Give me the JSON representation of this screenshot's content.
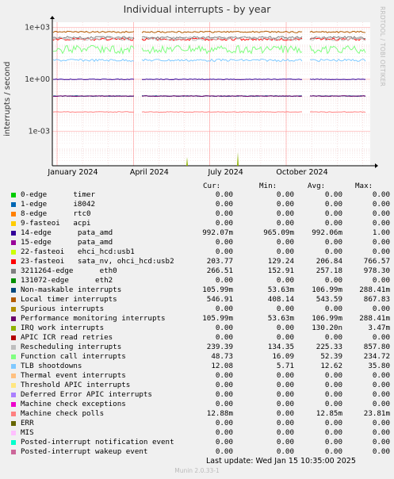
{
  "title": "Individual interrupts - by year",
  "side_text": "RRDTOOL / TOBI OETIKER",
  "footer_update": "Last update:  Wed Jan 15 10:35:00 2025",
  "footer_munin": "Munin 2.0.33-1",
  "chart_data": {
    "type": "line",
    "ylabel": "interrupts / second",
    "yscale": "log",
    "yticks": [
      "1e+03",
      "1e+00",
      "1e-03"
    ],
    "xticks": [
      "January 2024",
      "April 2024",
      "July 2024",
      "October 2024"
    ],
    "grid": true,
    "columns": [
      "Cur:",
      "Min:",
      "Avg:",
      "Max:"
    ],
    "series": [
      {
        "name": "0-edge      timer",
        "color": "#00cc00",
        "cur": "0.00",
        "min": "0.00",
        "avg": "0.00",
        "max": "0.00"
      },
      {
        "name": "1-edge      i8042",
        "color": "#0066b3",
        "cur": "0.00",
        "min": "0.00",
        "avg": "0.00",
        "max": "0.00"
      },
      {
        "name": "8-edge      rtc0",
        "color": "#ff8000",
        "cur": "0.00",
        "min": "0.00",
        "avg": "0.00",
        "max": "0.00"
      },
      {
        "name": "9-fasteoi   acpi",
        "color": "#ffcc00",
        "cur": "0.00",
        "min": "0.00",
        "avg": "0.00",
        "max": "0.00"
      },
      {
        "name": "14-edge      pata_amd",
        "color": "#330099",
        "cur": "992.07m",
        "min": "965.09m",
        "avg": "992.06m",
        "max": "1.00"
      },
      {
        "name": "15-edge      pata_amd",
        "color": "#990099",
        "cur": "0.00",
        "min": "0.00",
        "avg": "0.00",
        "max": "0.00"
      },
      {
        "name": "22-fasteoi   ehci_hcd:usb1",
        "color": "#ccff00",
        "cur": "0.00",
        "min": "0.00",
        "avg": "0.00",
        "max": "0.00"
      },
      {
        "name": "23-fasteoi   sata_nv, ohci_hcd:usb2",
        "color": "#ff0000",
        "cur": "203.77",
        "min": "129.24",
        "avg": "206.84",
        "max": "766.57"
      },
      {
        "name": "3211264-edge      eth0",
        "color": "#808080",
        "cur": "266.51",
        "min": "152.91",
        "avg": "257.18",
        "max": "978.30"
      },
      {
        "name": "131072-edge      eth2",
        "color": "#008f00",
        "cur": "0.00",
        "min": "0.00",
        "avg": "0.00",
        "max": "0.00"
      },
      {
        "name": "Non-maskable interrupts",
        "color": "#00487d",
        "cur": "105.99m",
        "min": "53.63m",
        "avg": "106.99m",
        "max": "288.41m"
      },
      {
        "name": "Local timer interrupts",
        "color": "#b35a00",
        "cur": "546.91",
        "min": "408.14",
        "avg": "543.59",
        "max": "867.83"
      },
      {
        "name": "Spurious interrupts",
        "color": "#b38f00",
        "cur": "0.00",
        "min": "0.00",
        "avg": "0.00",
        "max": "0.00"
      },
      {
        "name": "Performance monitoring interrupts",
        "color": "#6b006b",
        "cur": "105.99m",
        "min": "53.63m",
        "avg": "106.99m",
        "max": "288.41m"
      },
      {
        "name": "IRQ work interrupts",
        "color": "#8fb300",
        "cur": "0.00",
        "min": "0.00",
        "avg": "130.20n",
        "max": "3.47m"
      },
      {
        "name": "APIC ICR read retries",
        "color": "#b30000",
        "cur": "0.00",
        "min": "0.00",
        "avg": "0.00",
        "max": "0.00"
      },
      {
        "name": "Rescheduling interrupts",
        "color": "#bebebe",
        "cur": "239.39",
        "min": "134.35",
        "avg": "225.33",
        "max": "857.80"
      },
      {
        "name": "Function call interrupts",
        "color": "#80ff80",
        "cur": "48.73",
        "min": "16.09",
        "avg": "52.39",
        "max": "234.72"
      },
      {
        "name": "TLB shootdowns",
        "color": "#80c9ff",
        "cur": "12.08",
        "min": "5.71",
        "avg": "12.62",
        "max": "35.80"
      },
      {
        "name": "Thermal event interrupts",
        "color": "#ffc080",
        "cur": "0.00",
        "min": "0.00",
        "avg": "0.00",
        "max": "0.00"
      },
      {
        "name": "Threshold APIC interrupts",
        "color": "#ffe680",
        "cur": "0.00",
        "min": "0.00",
        "avg": "0.00",
        "max": "0.00"
      },
      {
        "name": "Deferred Error APIC interrupts",
        "color": "#aa80ff",
        "cur": "0.00",
        "min": "0.00",
        "avg": "0.00",
        "max": "0.00"
      },
      {
        "name": "Machine check exceptions",
        "color": "#ee00cc",
        "cur": "0.00",
        "min": "0.00",
        "avg": "0.00",
        "max": "0.00"
      },
      {
        "name": "Machine check polls",
        "color": "#ff8080",
        "cur": "12.88m",
        "min": "0.00",
        "avg": "12.85m",
        "max": "23.81m"
      },
      {
        "name": "ERR",
        "color": "#666600",
        "cur": "0.00",
        "min": "0.00",
        "avg": "0.00",
        "max": "0.00"
      },
      {
        "name": "MIS",
        "color": "#ffbfff",
        "cur": "0.00",
        "min": "0.00",
        "avg": "0.00",
        "max": "0.00"
      },
      {
        "name": "Posted-interrupt notification event",
        "color": "#00ffcc",
        "cur": "0.00",
        "min": "0.00",
        "avg": "0.00",
        "max": "0.00"
      },
      {
        "name": "Posted-interrupt wakeup event",
        "color": "#cc6699",
        "cur": "0.00",
        "min": "0.00",
        "avg": "0.00",
        "max": "0.00"
      }
    ]
  }
}
